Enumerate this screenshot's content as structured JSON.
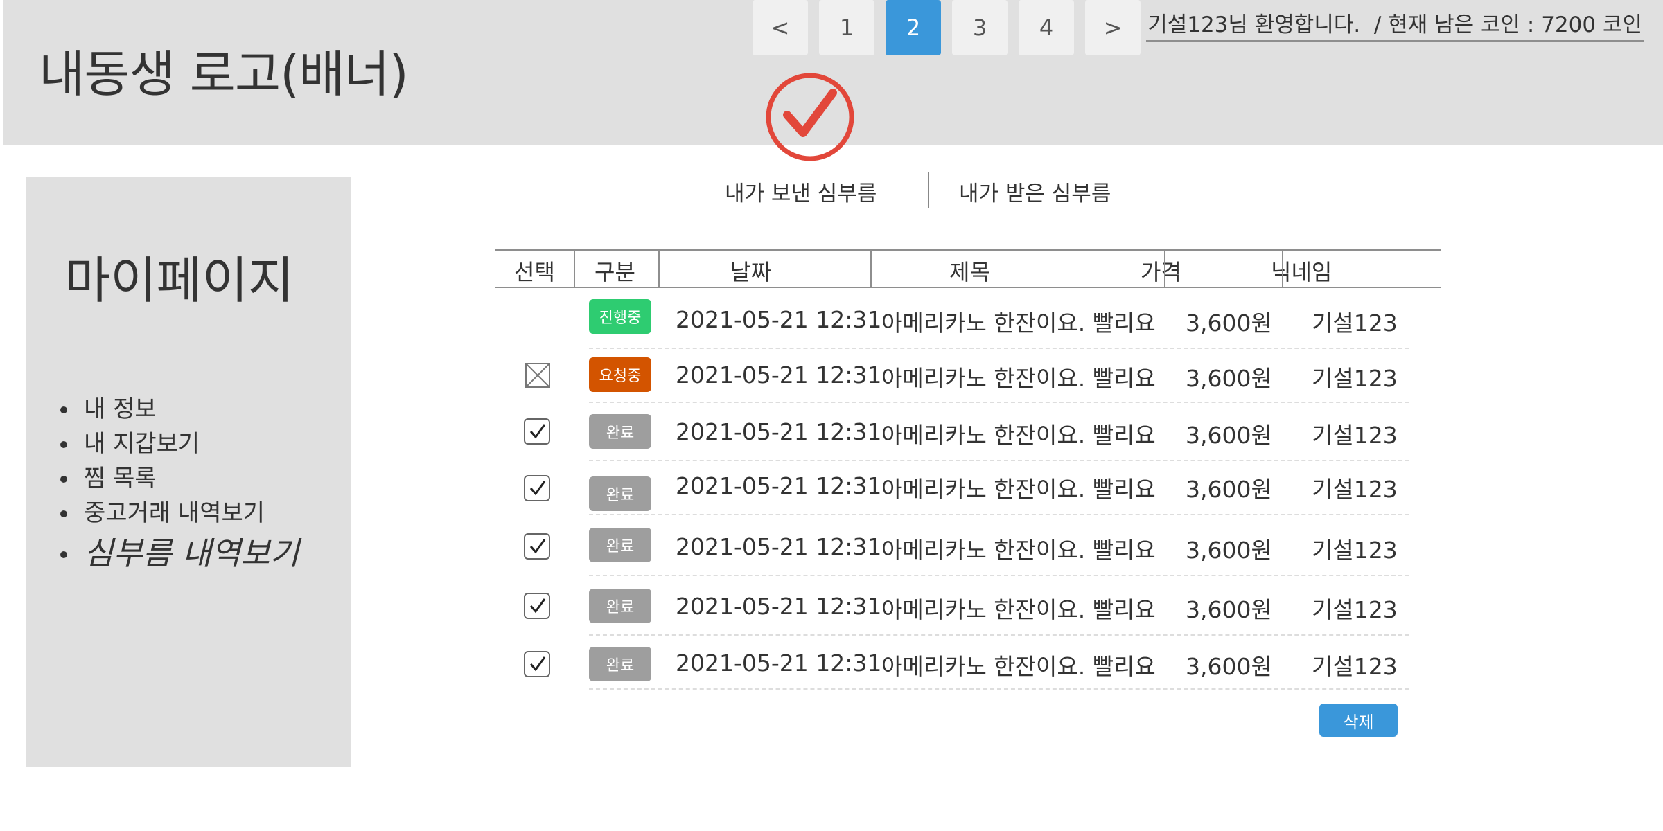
{
  "header": {
    "logo": "내동생 로고(배너)",
    "welcome": "기설123님 환영합니다.  / 현재 남은 코인 : 7200 코인",
    "accent_color": "#e2473a",
    "center_icon": "check-circle-icon"
  },
  "sidebar": {
    "title": "마이페이지",
    "items": [
      {
        "label": "내 정보"
      },
      {
        "label": "내 지갑보기"
      },
      {
        "label": "찜 목록"
      },
      {
        "label": "중고거래 내역보기"
      },
      {
        "label": "심부름 내역보기",
        "active": true
      }
    ]
  },
  "tabs": {
    "sent": "내가 보낸 심부름",
    "received": "내가 받은 심부름"
  },
  "table": {
    "headers": {
      "select": "선택",
      "category": "구분",
      "date": "날짜",
      "title": "제목",
      "price": "가격",
      "nickname": "닉네임"
    },
    "rows": [
      {
        "select": "none",
        "status": "진행중",
        "status_color": "#2ecc71",
        "date": "2021-05-21 12:31",
        "title": "아메리카노 한잔이요. 빨리요",
        "price": "3,600원",
        "nickname": "기설123"
      },
      {
        "select": "disabled",
        "status": "요청중",
        "status_color": "#d35400",
        "date": "2021-05-21 12:31",
        "title": "아메리카노 한잔이요. 빨리요",
        "price": "3,600원",
        "nickname": "기설123"
      },
      {
        "select": "checked",
        "status": "완료",
        "status_color": "#9e9e9e",
        "date": "2021-05-21 12:31",
        "title": "아메리카노 한잔이요. 빨리요",
        "price": "3,600원",
        "nickname": "기설123"
      },
      {
        "select": "checked",
        "status": "완료",
        "status_color": "#9e9e9e",
        "date": "2021-05-21 12:31",
        "title": "아메리카노 한잔이요. 빨리요",
        "price": "3,600원",
        "nickname": "기설123"
      },
      {
        "select": "checked",
        "status": "완료",
        "status_color": "#9e9e9e",
        "date": "2021-05-21 12:31",
        "title": "아메리카노 한잔이요. 빨리요",
        "price": "3,600원",
        "nickname": "기설123"
      },
      {
        "select": "checked",
        "status": "완료",
        "status_color": "#9e9e9e",
        "date": "2021-05-21 12:31",
        "title": "아메리카노 한잔이요. 빨리요",
        "price": "3,600원",
        "nickname": "기설123"
      },
      {
        "select": "checked",
        "status": "완료",
        "status_color": "#9e9e9e",
        "date": "2021-05-21 12:31",
        "title": "아메리카노 한잔이요. 빨리요",
        "price": "3,600원",
        "nickname": "기설123"
      }
    ]
  },
  "actions": {
    "delete_label": "삭제",
    "delete_color": "#3a97da"
  },
  "pagination": {
    "prev": "<",
    "next": ">",
    "pages": [
      "1",
      "2",
      "3",
      "4"
    ],
    "current": "2"
  }
}
